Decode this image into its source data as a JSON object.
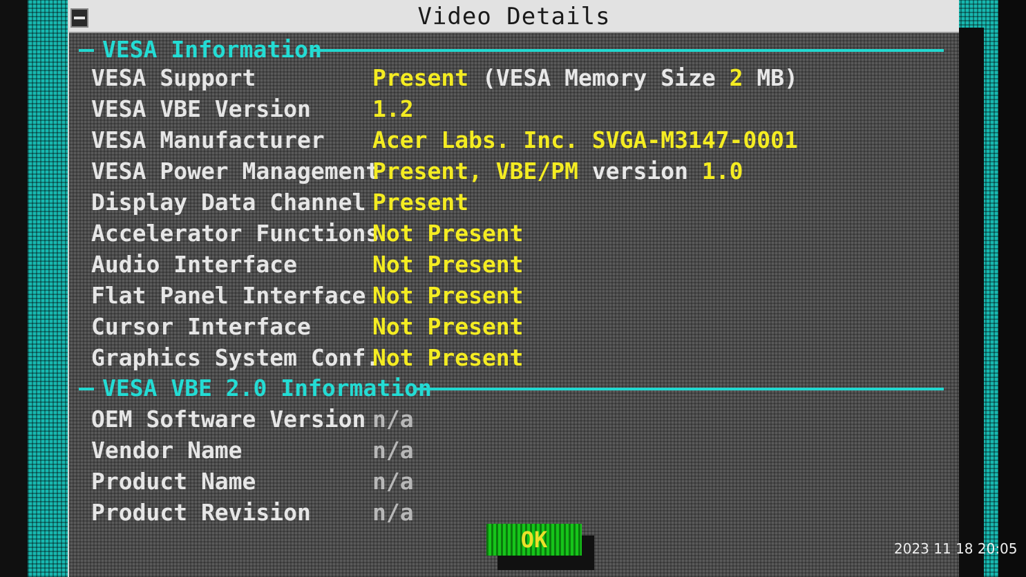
{
  "window": {
    "title": "Video Details"
  },
  "sections": {
    "vesa": {
      "label": "VESA Information"
    },
    "vbe2": {
      "label": "VESA VBE 2.0 Information"
    }
  },
  "vesa_rows": [
    {
      "key": "VESA Support",
      "v1": "Present",
      "v2": " (VESA Memory Size ",
      "v3": "2",
      "v4": " MB)"
    },
    {
      "key": "VESA VBE Version",
      "v1": "1.2"
    },
    {
      "key": "VESA Manufacturer",
      "v1": "Acer Labs. Inc. SVGA-M3147-0001"
    },
    {
      "key": "VESA Power Management",
      "v1": "Present, VBE/PM",
      "v2": " version ",
      "v3": "1.0"
    },
    {
      "key": "Display Data Channel",
      "v1": "Present"
    },
    {
      "key": "Accelerator Functions",
      "v1": "Not Present"
    },
    {
      "key": "Audio Interface",
      "v1": "Not Present"
    },
    {
      "key": "Flat Panel Interface",
      "v1": "Not Present"
    },
    {
      "key": "Cursor Interface",
      "v1": "Not Present"
    },
    {
      "key": "Graphics System Conf.",
      "v1": "Not Present"
    }
  ],
  "vbe2_rows": [
    {
      "key": "OEM Software Version",
      "v1": "n/a"
    },
    {
      "key": "Vendor Name",
      "v1": "n/a"
    },
    {
      "key": "Product Name",
      "v1": "n/a"
    },
    {
      "key": "Product Revision",
      "v1": "n/a"
    }
  ],
  "ok_label": "OK",
  "timestamp": "2023 11 18 20:05",
  "colors": {
    "desktop": "#18b8b0",
    "accent": "#22d8d0",
    "value": "#f4ec22",
    "ok_button": "#16c41a"
  }
}
